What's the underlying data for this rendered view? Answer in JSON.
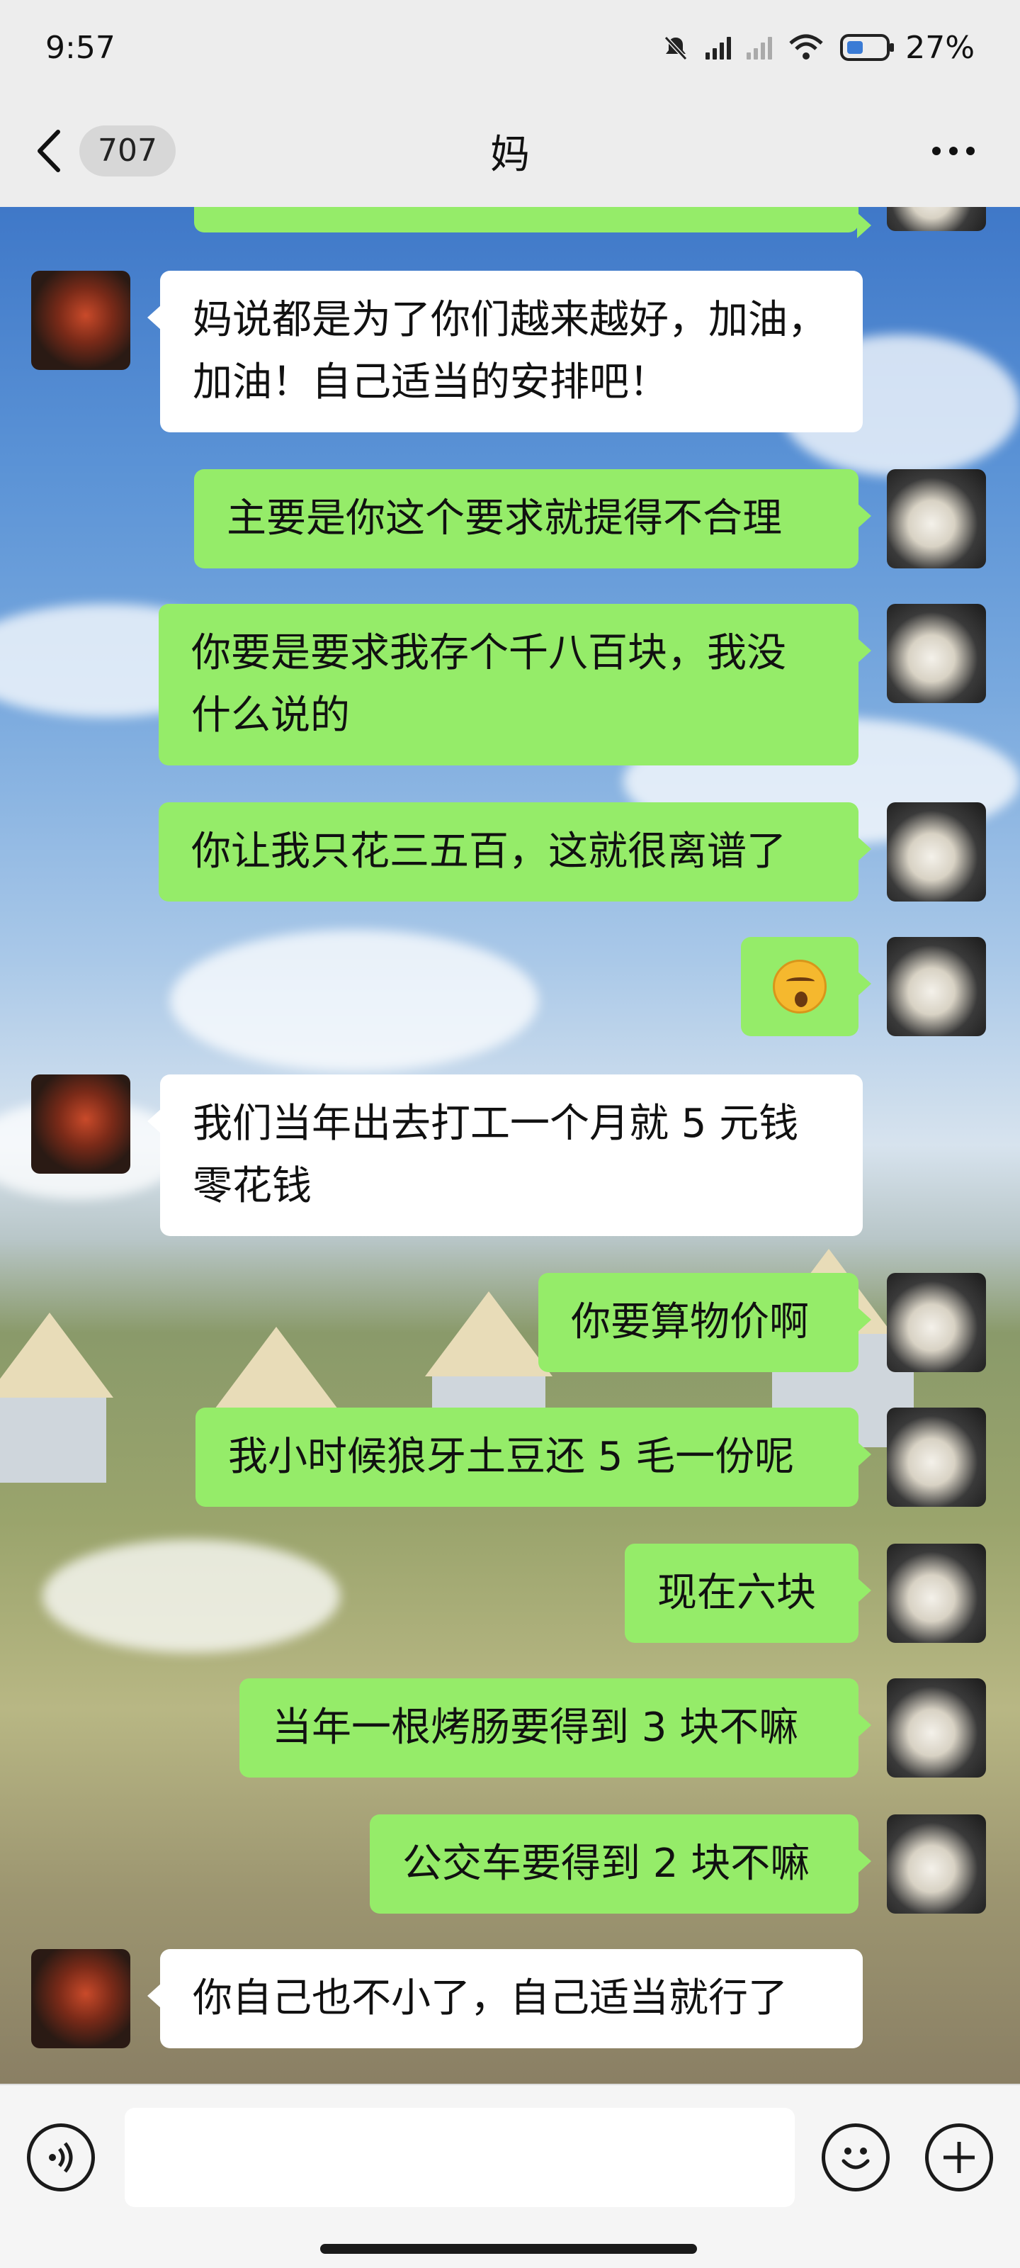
{
  "status_bar": {
    "time": "9:57",
    "battery": "27%"
  },
  "nav": {
    "unread_count": "707",
    "title": "妈"
  },
  "messages": [
    {
      "from": "me",
      "text": ""
    },
    {
      "from": "mom",
      "text": "妈说都是为了你们越来越好，加油，\n加油！自己适当的安排吧！"
    },
    {
      "from": "me",
      "text": "主要是你这个要求就提得不合理"
    },
    {
      "from": "me",
      "text": "你要是要求我存个千八百块，我没\n什么说的"
    },
    {
      "from": "me",
      "text": "你让我只花三五百，这就很离谱了"
    },
    {
      "from": "me",
      "text": "",
      "emoji": "speechless-face"
    },
    {
      "from": "mom",
      "text": "我们当年出去打工一个月就 5 元钱\n零花钱"
    },
    {
      "from": "me",
      "text": "你要算物价啊"
    },
    {
      "from": "me",
      "text": "我小时候狼牙土豆还 5 毛一份呢"
    },
    {
      "from": "me",
      "text": "现在六块"
    },
    {
      "from": "me",
      "text": "当年一根烤肠要得到 3 块不嘛"
    },
    {
      "from": "me",
      "text": "公交车要得到 2 块不嘛"
    },
    {
      "from": "mom",
      "text": "你自己也不小了，自己适当就行了"
    }
  ],
  "input": {
    "placeholder": ""
  }
}
